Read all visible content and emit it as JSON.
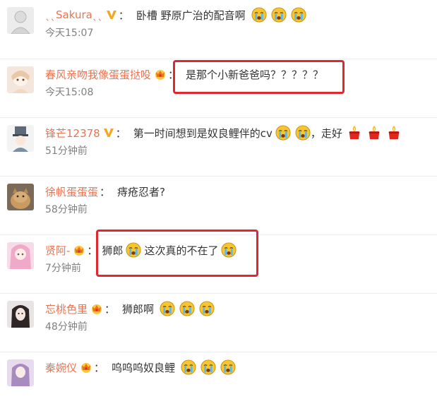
{
  "comments": [
    {
      "name": "ˎˎSakuraˎˎ",
      "badge": "v",
      "text": "卧槽 野原广治的配音啊",
      "time": "今天15:07"
    },
    {
      "name": "春风亲吻我像蛋蛋挞吺",
      "badge": "crown",
      "text": "是那个小新爸爸吗？？？？？",
      "time": "今天15:08"
    },
    {
      "name": "锋芒12378",
      "badge": "v",
      "text": "第一时间想到是奴良鲤伴的cv",
      "text2": "，走好",
      "time": "51分钟前"
    },
    {
      "name": "徐帆蛋蛋蛋",
      "badge": "",
      "text": "痔疮忍者?",
      "time": "58分钟前"
    },
    {
      "name": "贤阿-",
      "badge": "crown",
      "text": "狮郎",
      "text2": "这次真的不在了",
      "time": "7分钟前"
    },
    {
      "name": "忘桃色里",
      "badge": "crown",
      "text": "狮郎啊",
      "time": "48分钟前"
    },
    {
      "name": "秦婉仪",
      "badge": "crown",
      "text": "呜呜呜奴良鲤",
      "time": ""
    }
  ],
  "colon": "：",
  "colors": {
    "name": "#eb7350",
    "highlight": "#e0262f",
    "time": "#808080"
  }
}
